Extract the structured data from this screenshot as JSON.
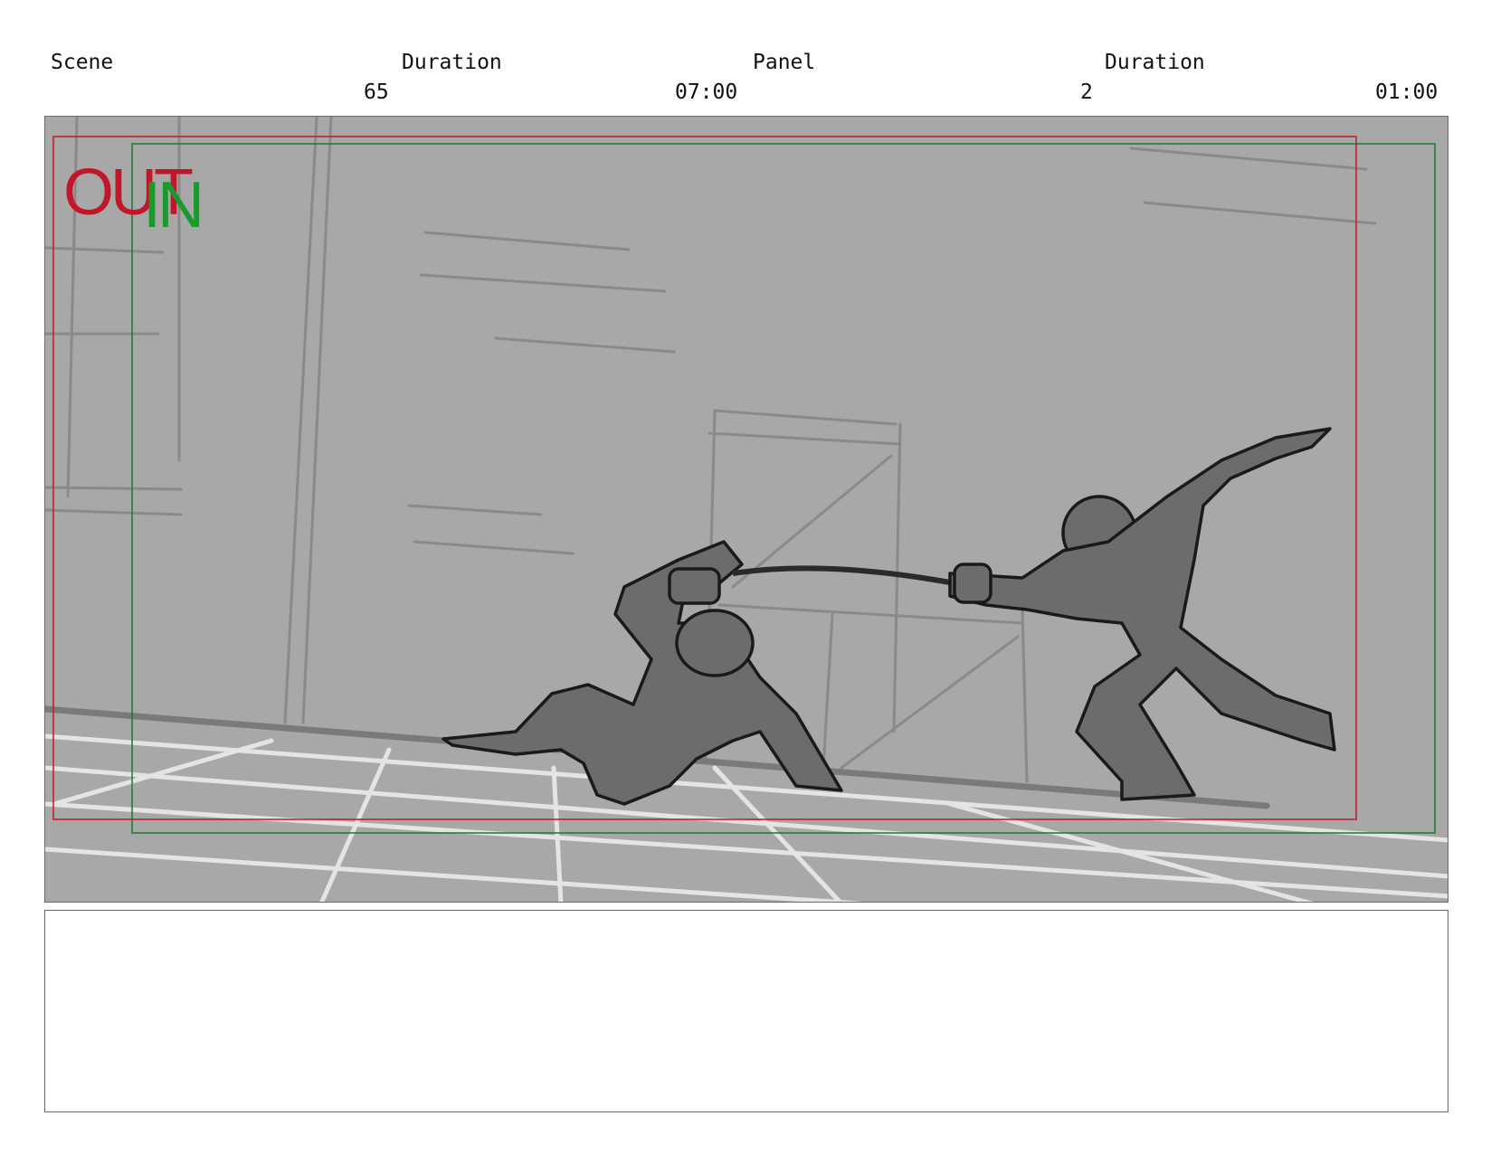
{
  "header": {
    "scene_label": "Scene",
    "scene_duration_label": "Duration",
    "panel_label": "Panel",
    "panel_duration_label": "Duration",
    "scene_number": "65",
    "scene_duration": "07:00",
    "panel_number": "2",
    "panel_duration": "01:00"
  },
  "frame": {
    "out_label": "OUT",
    "in_label": "IN",
    "out_color": "#c0182a",
    "in_color": "#1a9a2a",
    "background_color": "#a8a8a8"
  },
  "notes": {
    "text": ""
  }
}
